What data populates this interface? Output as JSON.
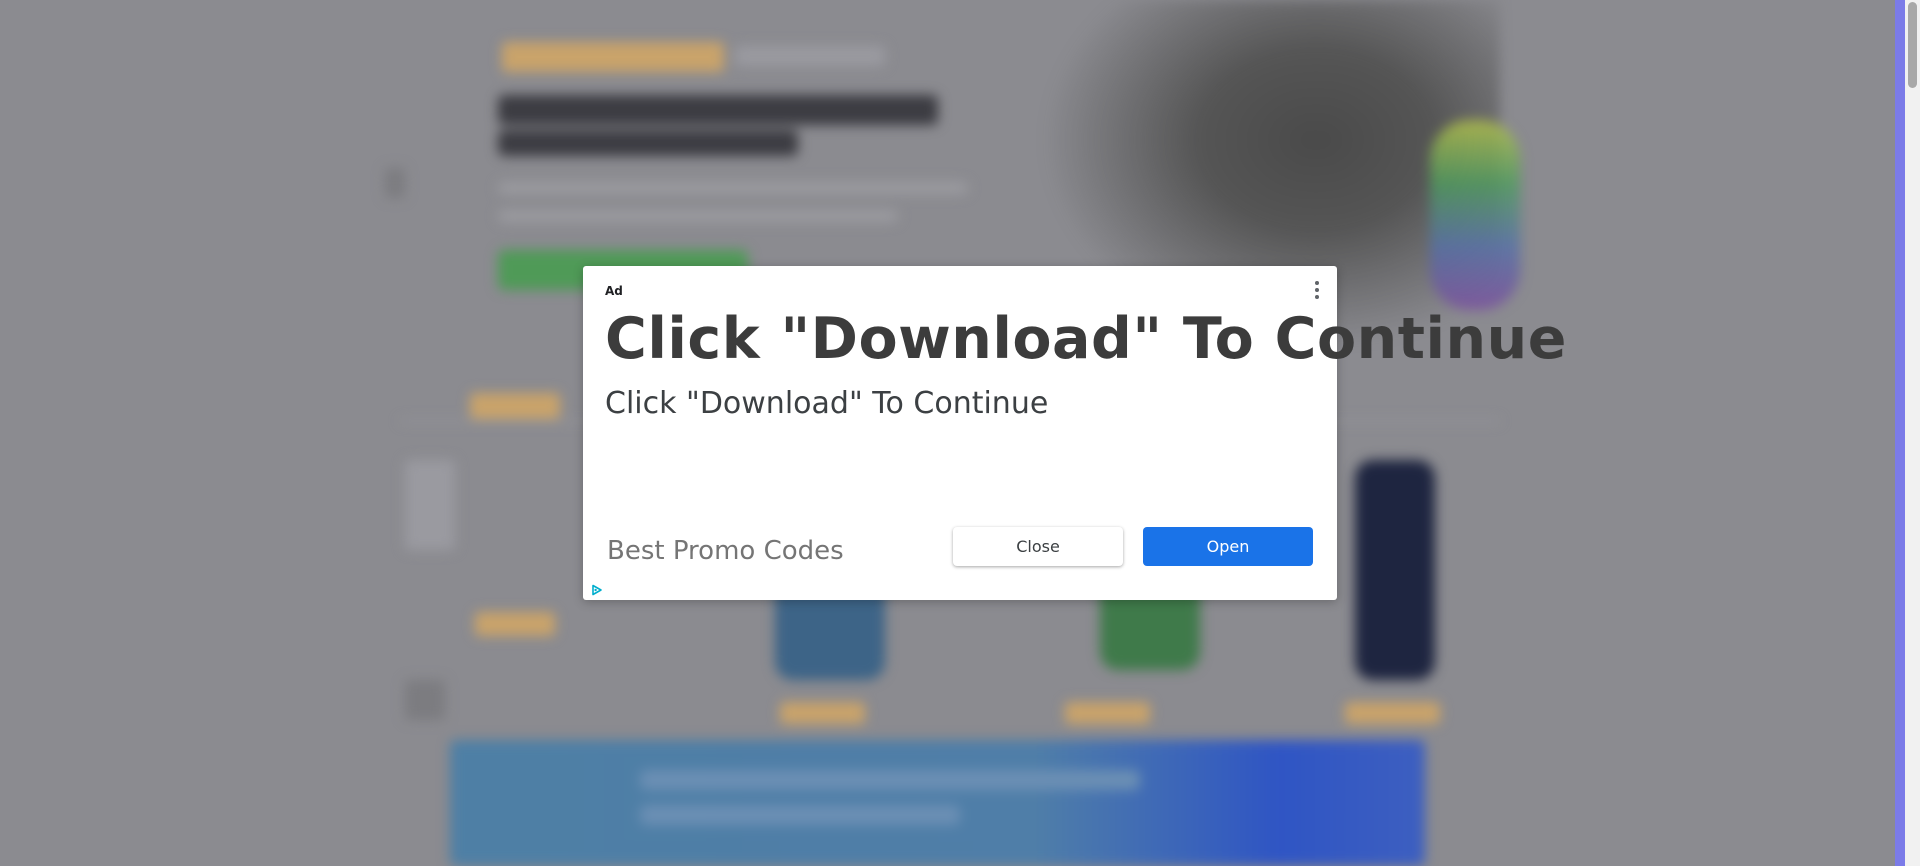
{
  "ad": {
    "label": "Ad",
    "headline": "Click \"Download\" To Continue",
    "subheadline": "Click \"Download\" To Continue",
    "advertiser": "Best Promo Codes",
    "close_label": "Close",
    "open_label": "Open",
    "icons": {
      "menu": "more-vert-icon",
      "adchoices": "adchoices-icon"
    }
  },
  "colors": {
    "overlay": "#8b8b90",
    "open_button": "#1a73e8",
    "dialog": "#ffffff"
  }
}
